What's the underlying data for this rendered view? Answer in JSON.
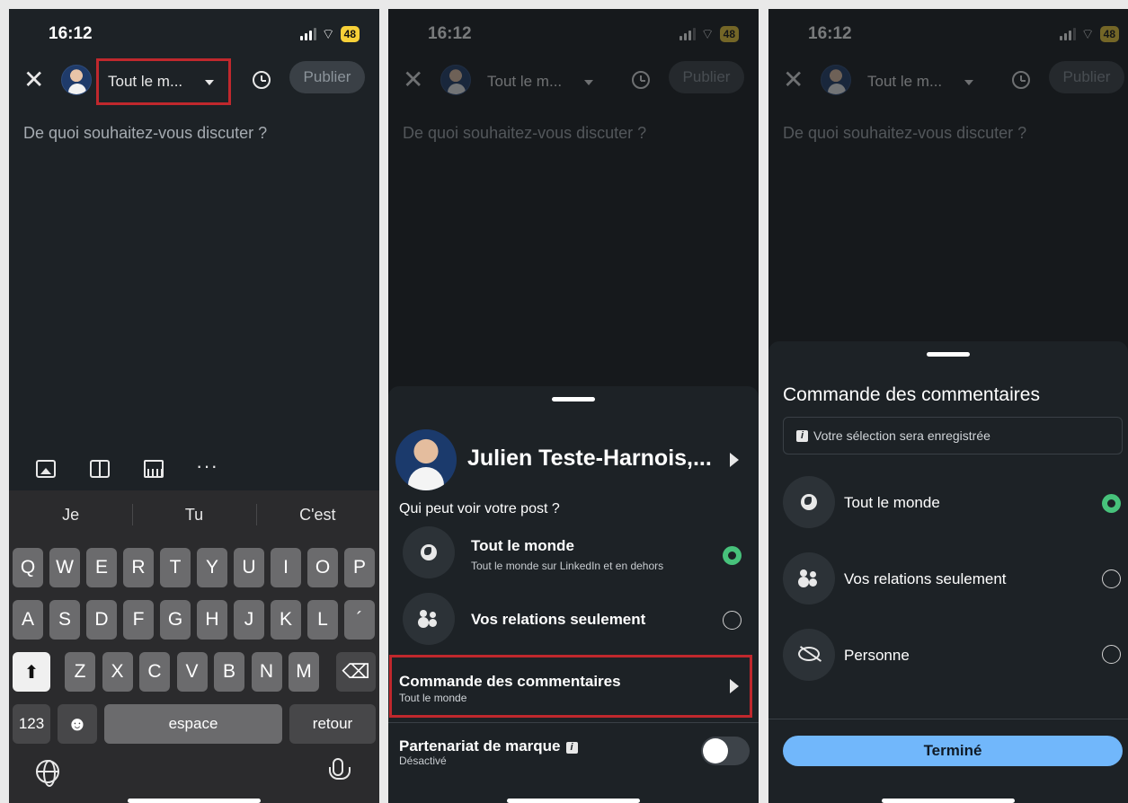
{
  "status": {
    "time": "16:12",
    "battery": "48"
  },
  "composer": {
    "audience_label": "Tout le m...",
    "publish_label": "Publier",
    "placeholder": "De quoi souhaitez-vous discuter ?"
  },
  "keyboard": {
    "suggestions": [
      "Je",
      "Tu",
      "C'est"
    ],
    "row1": [
      "Q",
      "W",
      "E",
      "R",
      "T",
      "Y",
      "U",
      "I",
      "O",
      "P"
    ],
    "row2": [
      "A",
      "S",
      "D",
      "F",
      "G",
      "H",
      "J",
      "K",
      "L",
      "´"
    ],
    "row3": [
      "Z",
      "X",
      "C",
      "V",
      "B",
      "N",
      "M"
    ],
    "numbers_label": "123",
    "space_label": "espace",
    "return_label": "retour",
    "emoji": "☻",
    "backspace": "⌫",
    "shift": "⬆"
  },
  "audience_sheet": {
    "user_name": "Julien Teste-Harnois,...",
    "question": "Qui peut voir votre post ?",
    "options": [
      {
        "label": "Tout le monde",
        "sub": "Tout le monde sur LinkedIn et en dehors",
        "selected": true
      },
      {
        "label": "Vos relations seulement",
        "sub": "",
        "selected": false
      }
    ],
    "comments_control": {
      "title": "Commande des commentaires",
      "value": "Tout le monde"
    },
    "brand_partnership": {
      "title": "Partenariat de marque",
      "status": "Désactivé",
      "info_icon": "i"
    }
  },
  "comments_sheet": {
    "title": "Commande des commentaires",
    "info_text": "Votre sélection sera enregistrée",
    "info_icon": "i",
    "options": [
      {
        "label": "Tout le monde",
        "selected": true
      },
      {
        "label": "Vos relations seulement",
        "selected": false
      },
      {
        "label": "Personne",
        "selected": false
      }
    ],
    "done_label": "Terminé"
  },
  "colors": {
    "accent_green": "#47c27b",
    "button_blue": "#71b7fb",
    "highlight_red": "#c0282d"
  }
}
